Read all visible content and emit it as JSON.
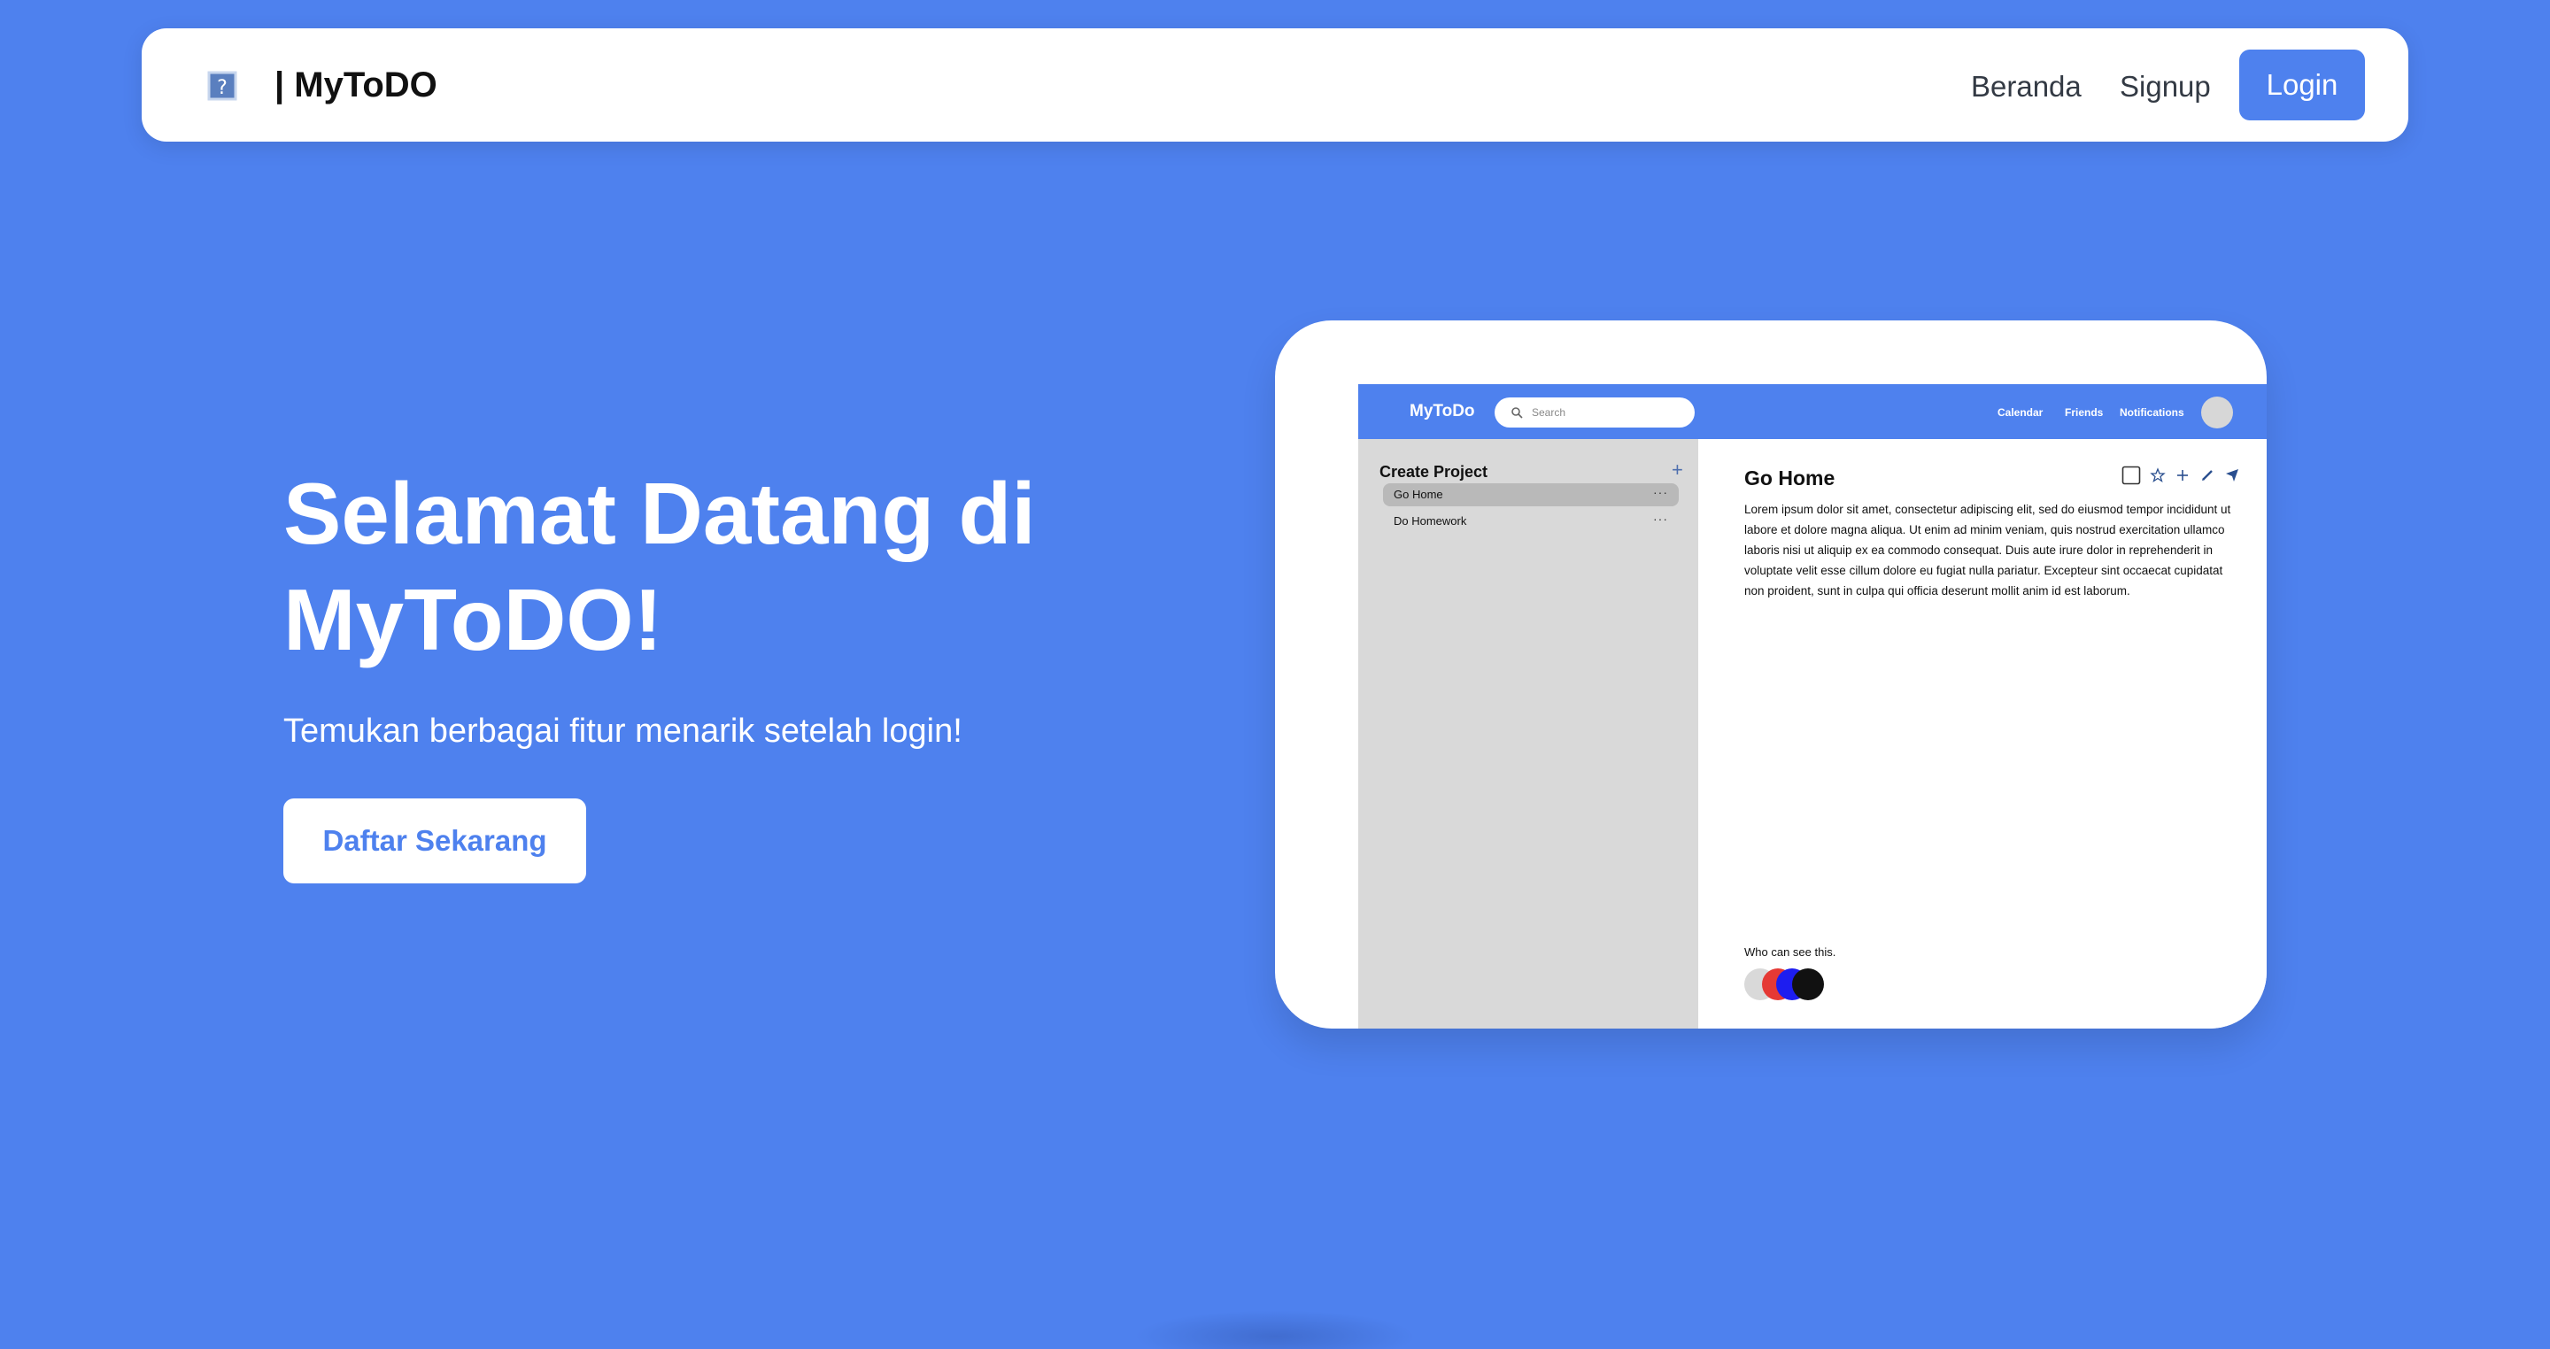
{
  "navbar": {
    "brand": "| MyToDO",
    "links": [
      "Beranda",
      "Signup"
    ],
    "login": "Login",
    "logo_icon": "broken-image-icon"
  },
  "hero": {
    "title": "Selamat Datang di MyToDO!",
    "subtitle": "Temukan berbagai fitur menarik setelah login!",
    "cta": "Daftar Sekarang"
  },
  "mockup": {
    "brand": "MyToDo",
    "search_placeholder": "Search",
    "nav_links": [
      "Calendar",
      "Friends",
      "Notifications"
    ],
    "sidebar_title": "Create Project",
    "add_icon": "plus-icon",
    "projects": [
      {
        "label": "Go Home",
        "active": true
      },
      {
        "label": "Do Homework",
        "active": false
      }
    ],
    "task_title": "Go Home",
    "task_tools": [
      "checkbox-icon",
      "star-icon",
      "plus-icon",
      "pencil-icon",
      "send-icon"
    ],
    "description": "Lorem ipsum dolor sit amet, consectetur adipiscing elit, sed do eiusmod tempor incididunt ut labore et dolore magna aliqua. Ut enim ad minim veniam, quis nostrud exercitation ullamco laboris nisi ut aliquip ex ea commodo consequat. Duis aute irure dolor in reprehenderit in voluptate velit esse cillum dolore eu fugiat nulla pariatur. Excepteur sint occaecat cupidatat non proident, sunt in culpa qui officia deserunt mollit anim id est laborum.",
    "visibility_label": "Who can see this.",
    "viewer_colors": [
      "#d9d9d9",
      "#e53935",
      "#1d1df0",
      "#111111"
    ]
  },
  "colors": {
    "background": "#4e81ee",
    "accent": "#4e81ee",
    "card": "#ffffff",
    "sidebar": "#d9d9d9"
  }
}
